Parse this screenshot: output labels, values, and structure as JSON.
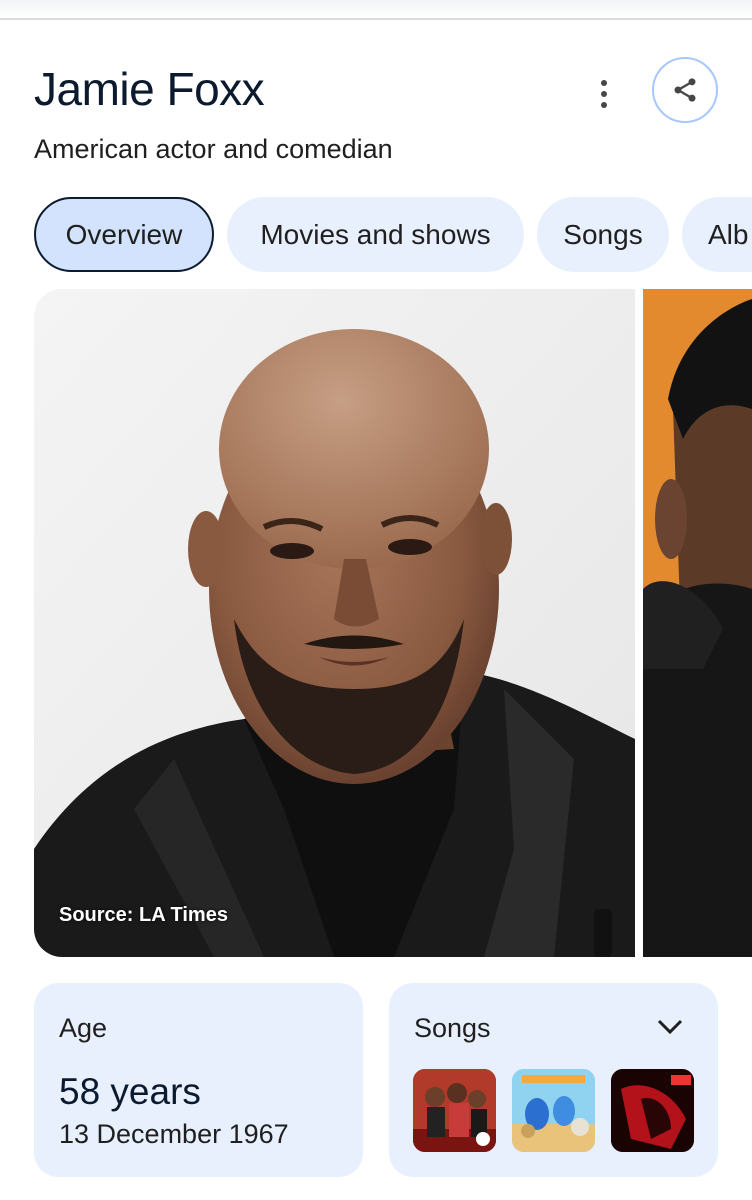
{
  "person": {
    "name": "Jamie Foxx",
    "description": "American actor and comedian"
  },
  "actions": {
    "more_icon": "more-vert-icon",
    "share_icon": "share-icon"
  },
  "tabs": [
    {
      "label": "Overview",
      "active": true
    },
    {
      "label": "Movies and shows",
      "active": false
    },
    {
      "label": "Songs",
      "active": false
    },
    {
      "label": "Alb",
      "active": false
    }
  ],
  "image": {
    "source": "Source: LA Times"
  },
  "age_card": {
    "label": "Age",
    "value": "58 years",
    "birth_date": "13 December 1967"
  },
  "songs_card": {
    "label": "Songs",
    "expand_icon": "chevron-down-icon"
  },
  "colors": {
    "accent_border": "#a8c7fa",
    "chip_bg": "#e8f0fe",
    "chip_active_bg": "#d3e3fd",
    "title_color": "#0b1a2e"
  }
}
